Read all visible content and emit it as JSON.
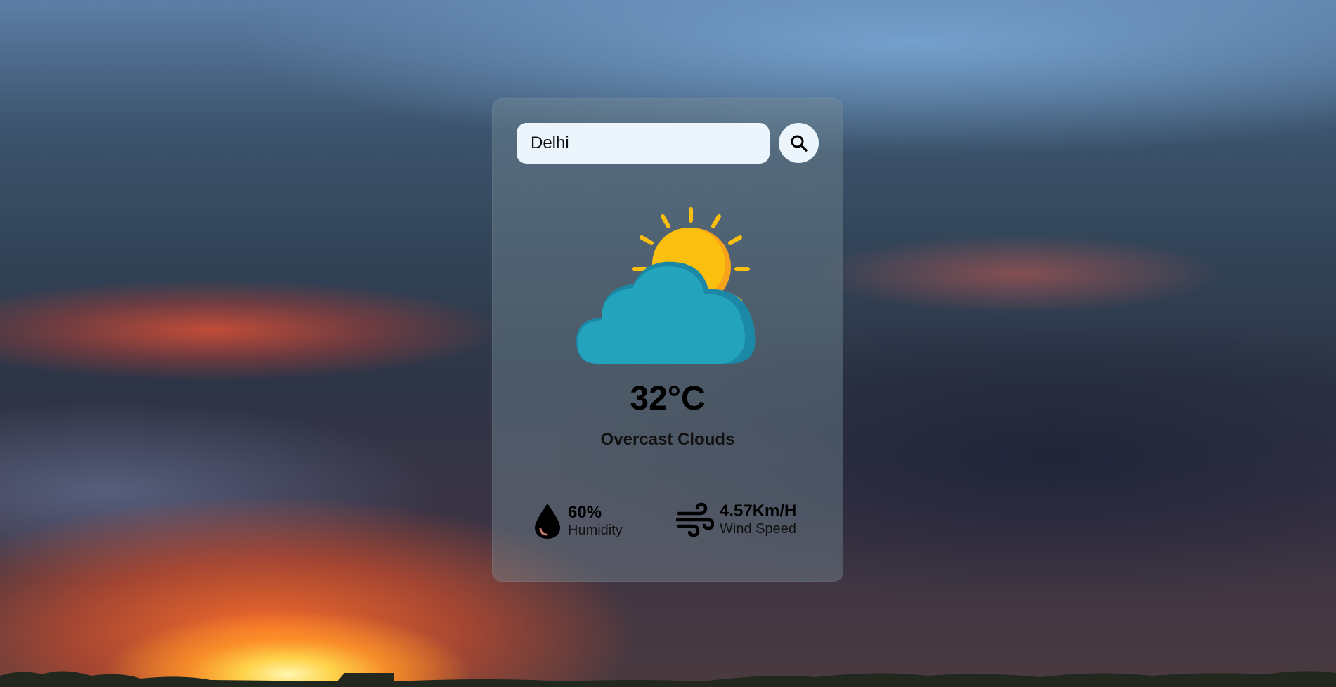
{
  "search": {
    "value": "Delhi",
    "button_icon": "search-icon"
  },
  "weather": {
    "icon": "partly-cloudy-icon",
    "temperature": "32°C",
    "description": "Overcast Clouds"
  },
  "details": {
    "humidity": {
      "icon": "water-drop-icon",
      "value": "60%",
      "label": "Humidity"
    },
    "wind": {
      "icon": "wind-icon",
      "value": "4.57Km/H",
      "label": "Wind Speed"
    }
  },
  "colors": {
    "card_background": "rgba(120,140,150,0.42)",
    "input_background": "#ebf5fb",
    "sun": "#fbbf0f",
    "sun_shade": "#f7a21b",
    "cloud": "#24a3bd",
    "cloud_shade": "#1b88a6"
  }
}
